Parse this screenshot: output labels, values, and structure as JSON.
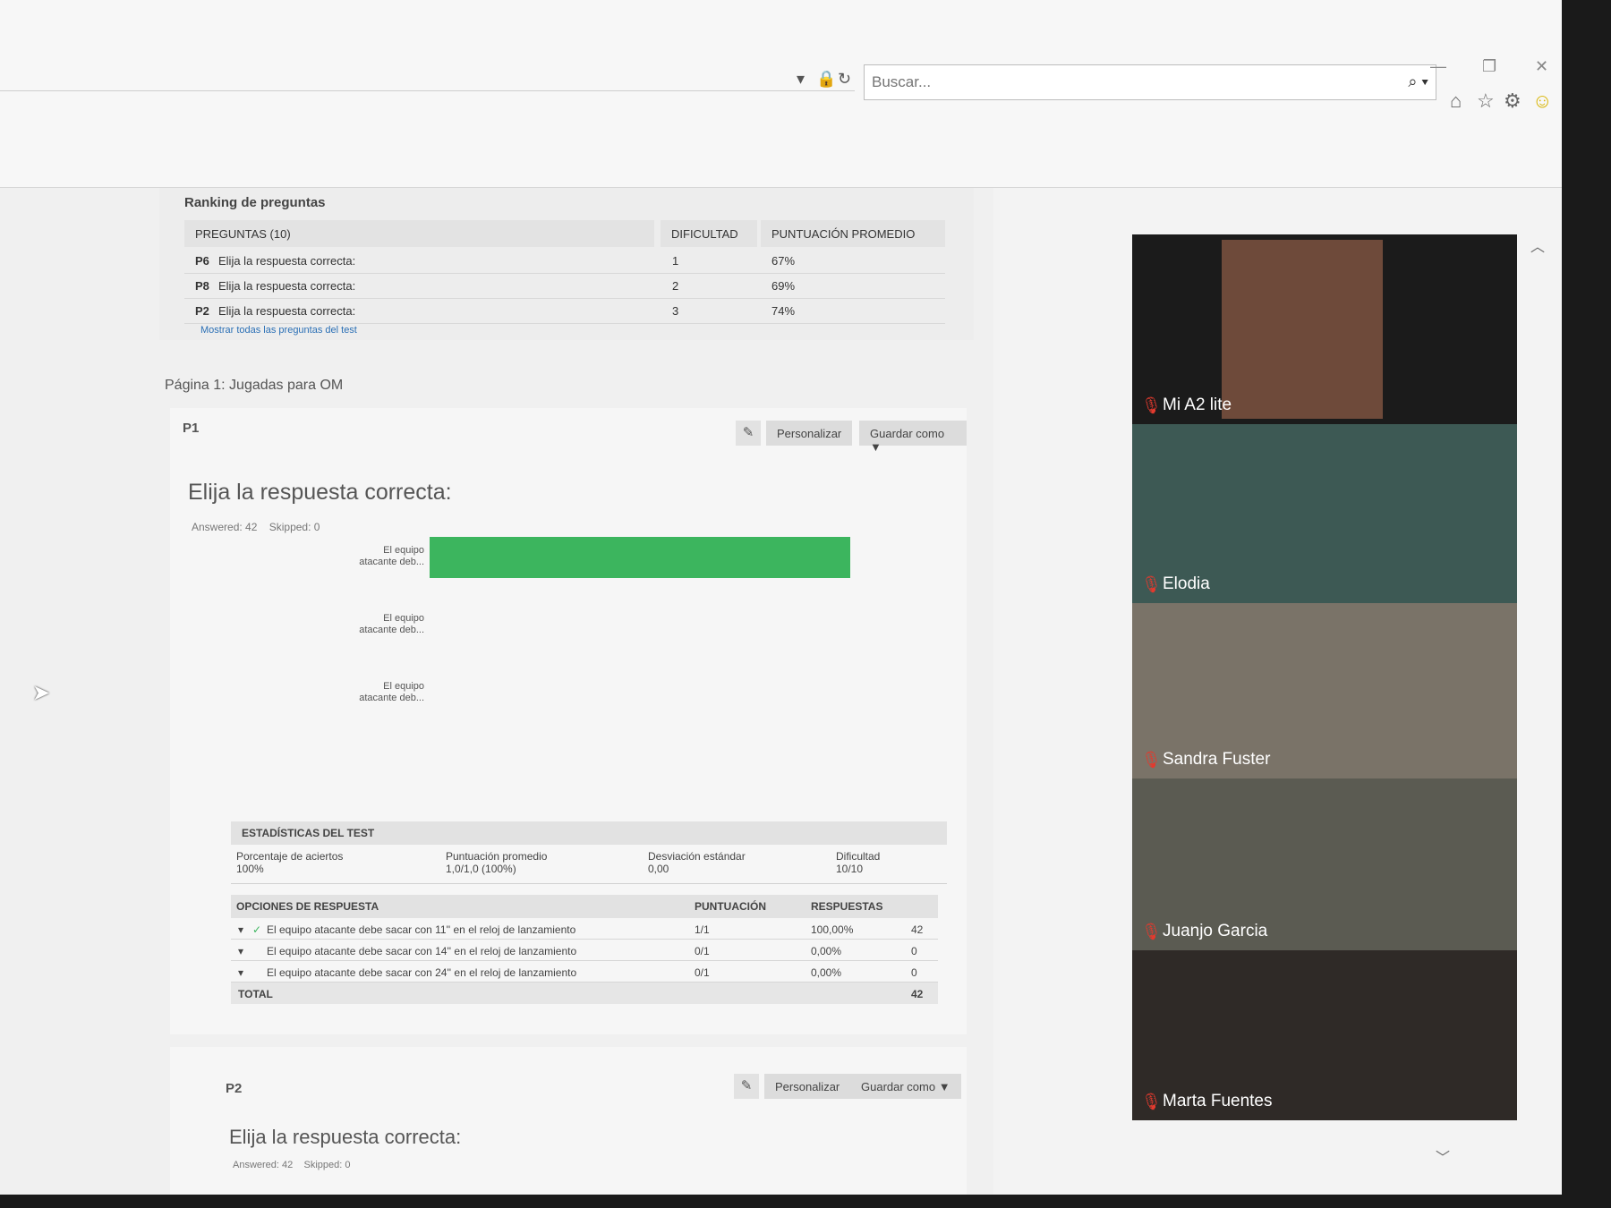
{
  "browser": {
    "search_placeholder": "Buscar...",
    "search_go_icon": "search-icon",
    "window_controls": [
      "minimize",
      "restore",
      "close"
    ],
    "toolbar_icons": [
      "home-icon",
      "star-icon",
      "gear-icon",
      "smiley-icon"
    ]
  },
  "ranking": {
    "title": "Ranking de preguntas",
    "columns": [
      "PREGUNTAS (10)",
      "DIFICULTAD",
      "PUNTUACIÓN PROMEDIO"
    ],
    "rows": [
      {
        "id": "P6",
        "text": "Elija la respuesta correcta:",
        "difficulty": "1",
        "score": "67%"
      },
      {
        "id": "P8",
        "text": "Elija la respuesta correcta:",
        "difficulty": "2",
        "score": "69%"
      },
      {
        "id": "P2",
        "text": "Elija la respuesta correcta:",
        "difficulty": "3",
        "score": "74%"
      }
    ],
    "show_all": "Mostrar todas las preguntas del test"
  },
  "page_label": "Página 1: Jugadas para OM",
  "q1": {
    "id": "P1",
    "customize": "Personalizar",
    "save_as": "Guardar como ▼",
    "title": "Elija la respuesta correcta:",
    "answered": "Answered: 42",
    "skipped": "Skipped: 0"
  },
  "chart_data": {
    "type": "bar",
    "orientation": "horizontal",
    "categories": [
      "El equipo atacante deb...",
      "El equipo atacante deb...",
      "El equipo atacante deb..."
    ],
    "category_lines": [
      [
        "El equipo",
        "atacante deb..."
      ],
      [
        "El equipo",
        "atacante deb..."
      ],
      [
        "El equipo",
        "atacante deb..."
      ]
    ],
    "values": [
      100,
      0,
      0
    ],
    "xlim": [
      0,
      100
    ],
    "xticks": [
      "0%",
      "10%",
      "20%",
      "30%",
      "40%",
      "50%",
      "60%",
      "70%",
      "80%",
      "90%",
      "100%"
    ],
    "bar_color": "#3cb55e",
    "grid": false
  },
  "test_stats": {
    "title": "ESTADÍSTICAS DEL TEST",
    "cells": [
      {
        "label": "Porcentaje de aciertos",
        "value": "100%"
      },
      {
        "label": "Puntuación promedio",
        "value": "1,0/1,0 (100%)"
      },
      {
        "label": "Desviación estándar",
        "value": "0,00"
      },
      {
        "label": "Dificultad",
        "value": "10/10"
      }
    ]
  },
  "options": {
    "columns": [
      "OPCIONES DE RESPUESTA",
      "PUNTUACIÓN",
      "RESPUESTAS"
    ],
    "rows": [
      {
        "text": "El equipo atacante debe sacar con 11'' en el reloj de lanzamiento",
        "score": "1/1",
        "pct": "100,00%",
        "count": "42",
        "correct": true
      },
      {
        "text": "El equipo atacante debe sacar con 14'' en el reloj de lanzamiento",
        "score": "0/1",
        "pct": "0,00%",
        "count": "0",
        "correct": false
      },
      {
        "text": "El equipo atacante debe sacar con 24'' en el reloj de lanzamiento",
        "score": "0/1",
        "pct": "0,00%",
        "count": "0",
        "correct": false
      }
    ],
    "total_label": "TOTAL",
    "total": "42"
  },
  "q2": {
    "id": "P2",
    "customize": "Personalizar",
    "save_as": "Guardar como ▼",
    "title": "Elija la respuesta correcta:",
    "answered": "Answered: 42",
    "skipped": "Skipped: 0"
  },
  "participants": [
    {
      "name": "Mi A2 lite",
      "muted": true,
      "bg": "#6e4a3a"
    },
    {
      "name": "Elodia",
      "muted": true,
      "bg": "#3d5954"
    },
    {
      "name": "Sandra Fuster",
      "muted": true,
      "bg": "#7a7368"
    },
    {
      "name": "Juanjo Garcia",
      "muted": true,
      "bg": "#5b5b52"
    },
    {
      "name": "Marta Fuentes",
      "muted": true,
      "bg": "#2f2a27"
    }
  ]
}
